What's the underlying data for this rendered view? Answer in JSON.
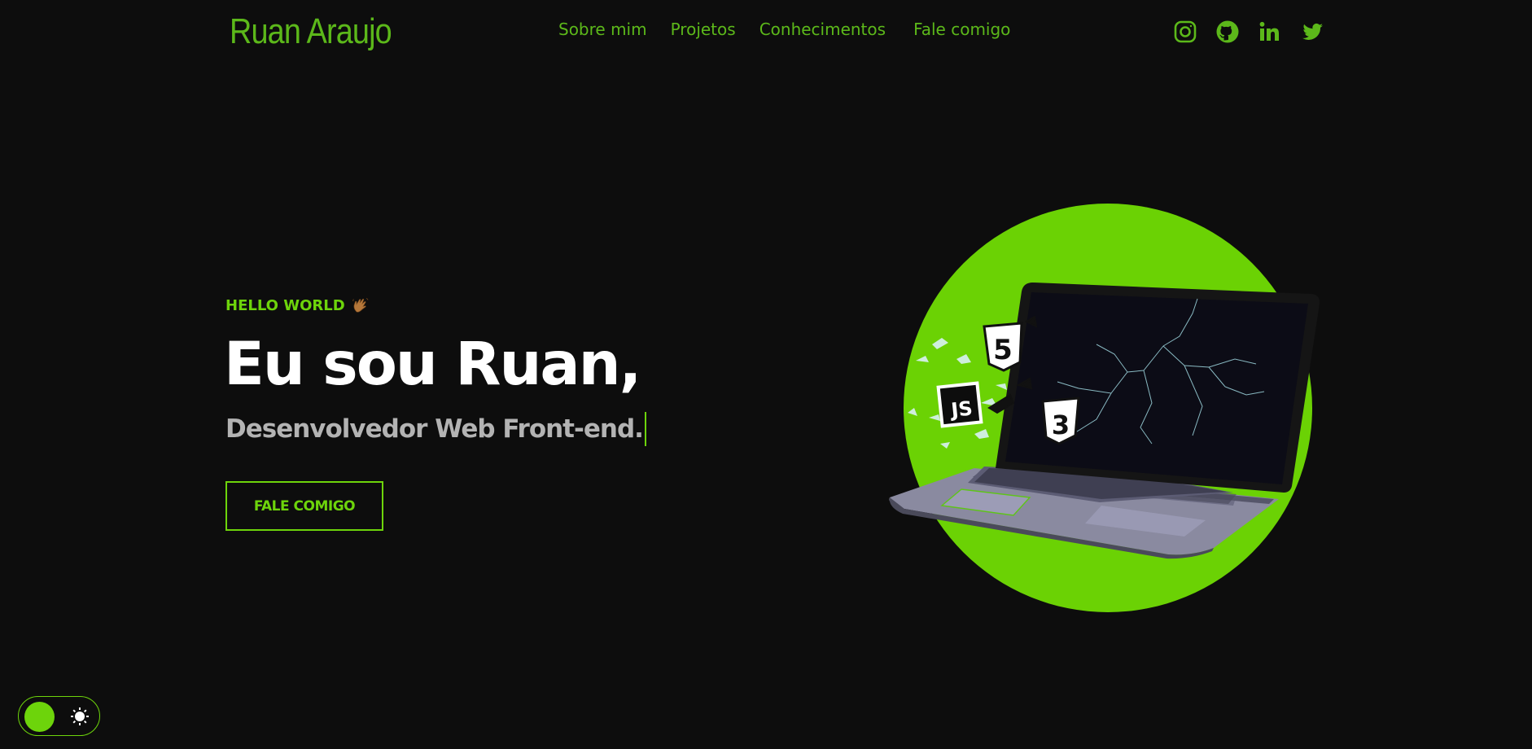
{
  "header": {
    "logo": "Ruan Araujo",
    "nav": [
      "Sobre mim",
      "Projetos",
      "Conhecimentos",
      "Fale comigo"
    ],
    "social_icons": [
      "instagram-icon",
      "github-icon",
      "linkedin-icon",
      "twitter-icon"
    ]
  },
  "hero": {
    "eyebrow": "HELLO WORLD",
    "eyebrow_icon": "waving-hand-icon",
    "headline": "Eu sou Ruan,",
    "subline": "Desenvolvedor Web Front-end.",
    "cta_label": "FALE COMIGO",
    "image_badges": [
      "5",
      "JS",
      "3"
    ]
  },
  "theme_toggle": {
    "icon": "sun-icon",
    "state": "dark"
  },
  "colors": {
    "accent": "#6dd40b",
    "nav_text": "#5cb81a",
    "background": "#0d0d0d",
    "headline": "#ffffff",
    "subline": "#b3b3b3"
  }
}
